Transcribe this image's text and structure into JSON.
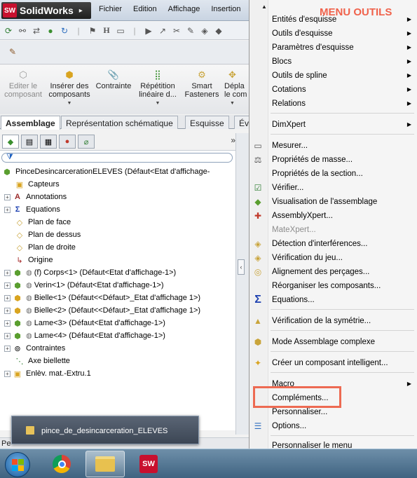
{
  "app": {
    "name": "SolidWorks",
    "logo_badge": "SW",
    "menus": [
      "Fichier",
      "Edition",
      "Affichage",
      "Insertion"
    ]
  },
  "command_manager": {
    "buttons": [
      {
        "label": "Editer le composant",
        "lines": [
          "Editer le",
          "composant"
        ],
        "enabled": false
      },
      {
        "label": "Insérer des composants",
        "lines": [
          "Insérer des",
          "composants"
        ],
        "enabled": true,
        "dropdown": true
      },
      {
        "label": "Contrainte",
        "lines": [
          "Contrainte"
        ],
        "enabled": true
      },
      {
        "label": "Répétition linéaire d...",
        "lines": [
          "Répétition",
          "linéaire d..."
        ],
        "enabled": true,
        "dropdown": true
      },
      {
        "label": "Smart Fasteners",
        "lines": [
          "Smart",
          "Fasteners"
        ],
        "enabled": true
      },
      {
        "label": "Dépl... le co...",
        "lines": [
          "Dépla",
          "le com"
        ],
        "enabled": true,
        "dropdown": true
      }
    ]
  },
  "tabs": [
    "Assemblage",
    "Représentation schématique",
    "Esquisse",
    "Év"
  ],
  "active_tab": "Assemblage",
  "feature_tree": {
    "root": "PinceDesincarcerationELEVES  (Défaut<Etat d'affichage-",
    "items": [
      {
        "label": "Capteurs",
        "icon": "sensor-folder-icon"
      },
      {
        "label": "Annotations",
        "icon": "annotation-icon",
        "expand": "+"
      },
      {
        "label": "Equations",
        "icon": "equation-icon",
        "expand": "+"
      },
      {
        "label": "Plan de face",
        "icon": "plane-icon"
      },
      {
        "label": "Plan de dessus",
        "icon": "plane-icon"
      },
      {
        "label": "Plan de droite",
        "icon": "plane-icon"
      },
      {
        "label": "Origine",
        "icon": "origin-icon"
      },
      {
        "label": "(f) Corps<1> (Défaut<Etat d'affichage-1>)",
        "icon": "part-icon",
        "expand": "+"
      },
      {
        "label": "Verin<1> (Défaut<Etat d'affichage-1>)",
        "icon": "part-icon",
        "expand": "+"
      },
      {
        "label": "Bielle<1> (Défaut<<Défaut>_Etat d'affichage 1>)",
        "icon": "part-icon",
        "expand": "+"
      },
      {
        "label": "Bielle<2> (Défaut<<Défaut>_Etat d'affichage 1>)",
        "icon": "part-icon",
        "expand": "+"
      },
      {
        "label": "Lame<3> (Défaut<Etat d'affichage-1>)",
        "icon": "part-icon",
        "expand": "+"
      },
      {
        "label": "Lame<4> (Défaut<Etat d'affichage-1>)",
        "icon": "part-icon",
        "expand": "+"
      },
      {
        "label": "Contraintes",
        "icon": "mates-icon",
        "expand": "+"
      },
      {
        "label": "Axe biellette",
        "icon": "axis-icon"
      },
      {
        "label": "Enlèv. mat.-Extru.1",
        "icon": "cut-extrude-icon",
        "expand": "+"
      }
    ]
  },
  "status_bar": {
    "text": "Pe"
  },
  "taskbar_tooltip": {
    "label": "pince_de_desincarceration_ELEVES"
  },
  "menu": {
    "title": "MENU OUTILS",
    "highlight_color": "#ed6a52",
    "items": [
      {
        "label": "Entités d'esquisse",
        "submenu": true
      },
      {
        "label": "Outils d'esquisse",
        "submenu": true
      },
      {
        "label": "Paramètres d'esquisse",
        "submenu": true
      },
      {
        "label": "Blocs",
        "submenu": true
      },
      {
        "label": "Outils de spline",
        "submenu": true
      },
      {
        "label": "Cotations",
        "submenu": true
      },
      {
        "label": "Relations",
        "submenu": true
      },
      {
        "label": "DimXpert",
        "submenu": true
      },
      {
        "label": "Mesurer...",
        "icon": "measure-icon"
      },
      {
        "label": "Propriétés de masse...",
        "icon": "mass-properties-icon"
      },
      {
        "label": "Propriétés de la section...",
        "icon": "section-properties-icon"
      },
      {
        "label": "Vérifier...",
        "icon": "check-icon"
      },
      {
        "label": "Visualisation de l'assemblage",
        "icon": "assembly-visualization-icon"
      },
      {
        "label": "AssemblyXpert...",
        "icon": "assemblyxpert-icon"
      },
      {
        "label": "MateXpert...",
        "disabled": true
      },
      {
        "label": "Détection d'interférences...",
        "icon": "interference-icon"
      },
      {
        "label": "Vérification du jeu...",
        "icon": "clearance-icon"
      },
      {
        "label": "Alignement des perçages...",
        "icon": "hole-alignment-icon"
      },
      {
        "label": "Réorganiser les composants...",
        "icon": "reorganize-icon"
      },
      {
        "label": "Equations...",
        "icon": "sigma-icon"
      },
      {
        "label": "Vérification de la symétrie...",
        "icon": "symmetry-icon"
      },
      {
        "label": "Mode Assemblage complexe",
        "icon": "large-assembly-icon"
      },
      {
        "label": "Créer un composant intelligent...",
        "icon": "smart-component-icon"
      },
      {
        "label": "Macro",
        "submenu": true
      },
      {
        "label": "Compléments..."
      },
      {
        "label": "Personnaliser..."
      },
      {
        "label": "Options...",
        "icon": "options-icon"
      },
      {
        "label": "Personnaliser le menu"
      }
    ]
  }
}
